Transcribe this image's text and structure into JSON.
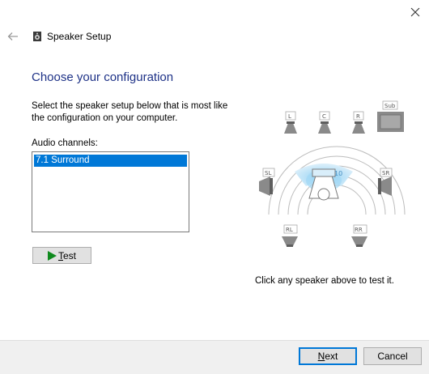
{
  "window": {
    "title": "Speaker Setup",
    "close_icon": "close-icon",
    "back_icon": "back-arrow-icon",
    "app_icon": "speaker-icon"
  },
  "page": {
    "heading": "Choose your configuration",
    "instructions": "Select the speaker setup below that is most like the configuration on your computer.",
    "channels_label": "Audio channels:",
    "channels": [
      "7.1 Surround"
    ],
    "selected_channel": "7.1 Surround",
    "test_button": {
      "prefix": "",
      "mnemonic": "T",
      "rest": "est"
    },
    "hint": "Click any speaker above to test it."
  },
  "speakers": {
    "front_left": "L",
    "center": "C",
    "front_right": "R",
    "subwoofer": "Sub",
    "side_left": "SL",
    "side_right": "SR",
    "rear_left": "RL",
    "rear_right": "RR"
  },
  "footer": {
    "next": {
      "mnemonic": "N",
      "rest": "ext"
    },
    "cancel": "Cancel"
  },
  "colors": {
    "heading": "#1e3287",
    "selection": "#0078d7",
    "play_icon": "#0f8a1e"
  }
}
